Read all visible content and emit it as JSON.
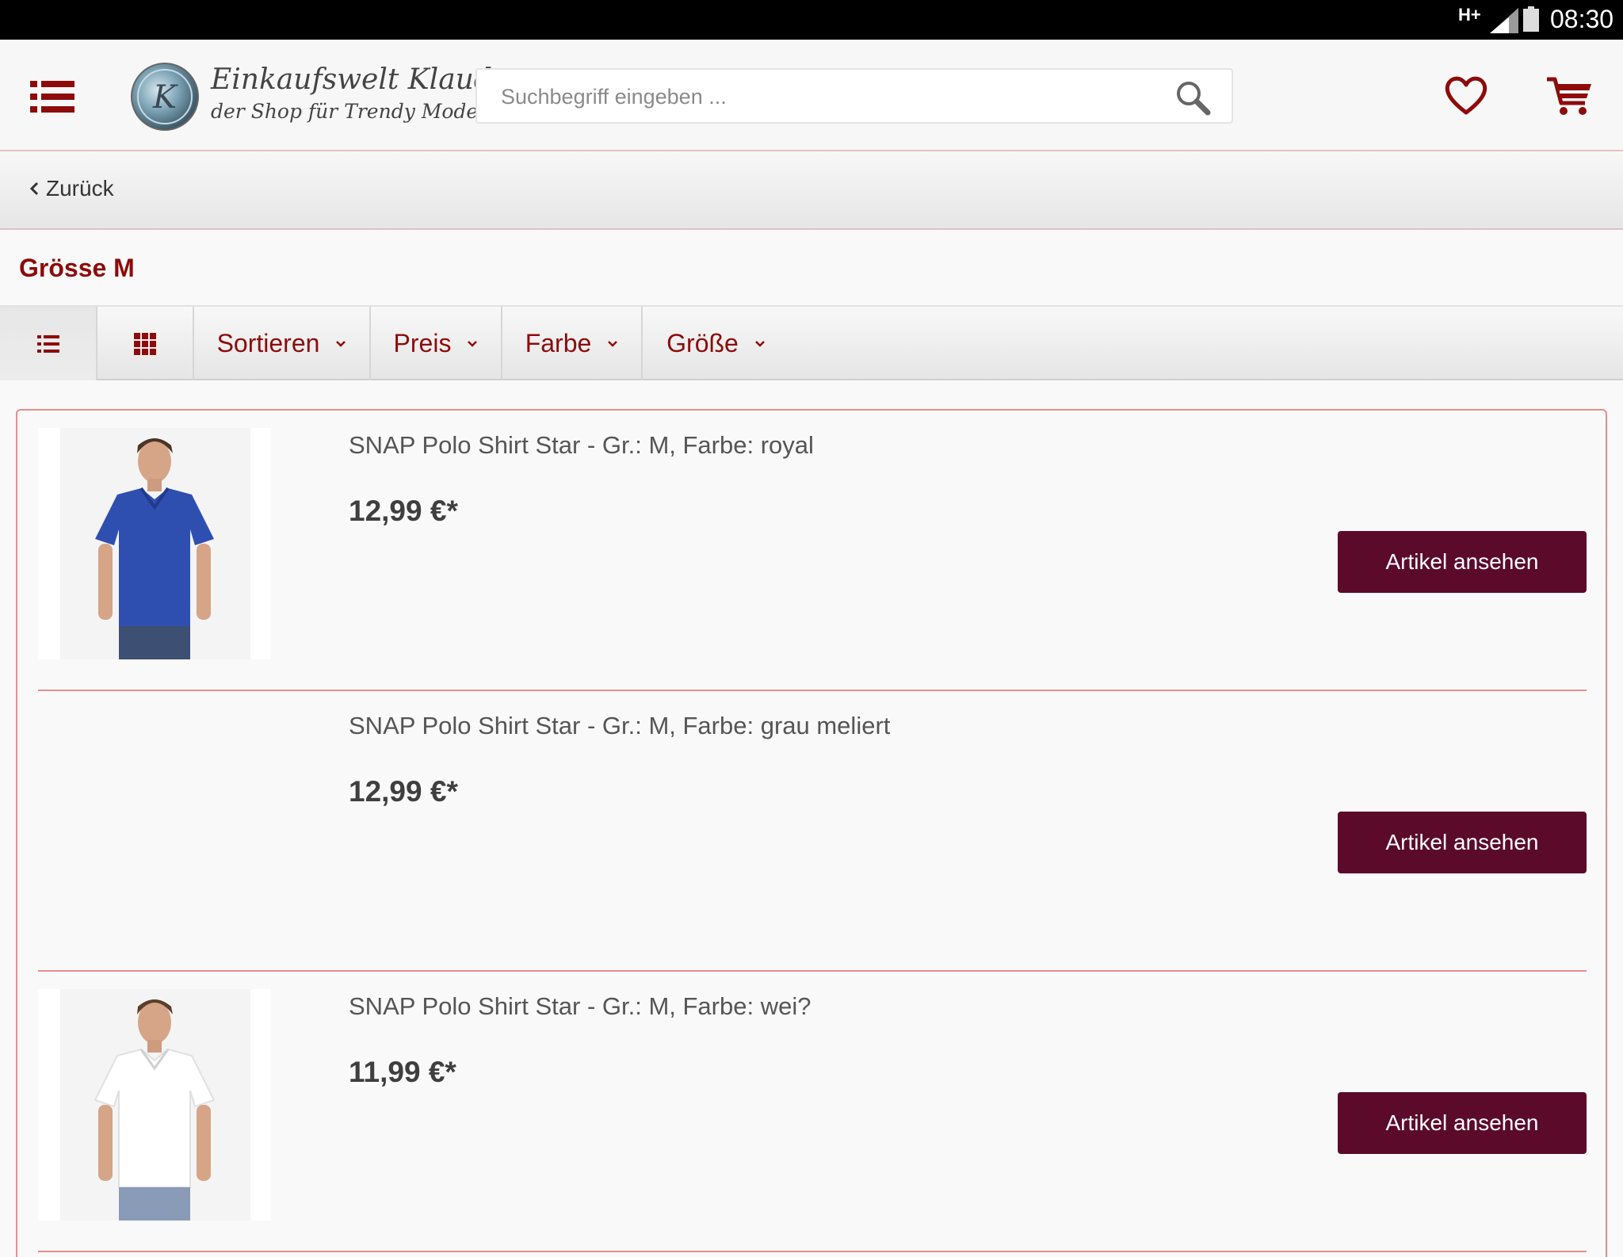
{
  "status_bar": {
    "network": "H+",
    "time": "08:30"
  },
  "header": {
    "logo_line1": "Einkaufswelt Klaudy",
    "logo_line2": "der Shop für Trendy Mode",
    "logo_seal_letter": "K",
    "search_placeholder": "Suchbegriff eingeben ...",
    "icons": [
      "menu-icon",
      "search-icon",
      "heart-icon",
      "cart-icon"
    ]
  },
  "back_label": "Zurück",
  "category_title": "Grösse M",
  "toolbar": {
    "list_view_icon": "list-view-icon",
    "grid_view_icon": "grid-view-icon",
    "filters": [
      {
        "label": "Sortieren"
      },
      {
        "label": "Preis"
      },
      {
        "label": "Farbe"
      },
      {
        "label": "Größe"
      }
    ]
  },
  "products": [
    {
      "name": "SNAP Polo Shirt Star - Gr.: M, Farbe: royal",
      "price": "12,99 €*",
      "button": "Artikel ansehen",
      "image_color": "#2f4fb0"
    },
    {
      "name": "SNAP Polo Shirt Star - Gr.: M, Farbe: grau meliert",
      "price": "12,99 €*",
      "button": "Artikel ansehen",
      "image_color": ""
    },
    {
      "name": "SNAP Polo Shirt Star - Gr.: M, Farbe: wei?",
      "price": "11,99 €*",
      "button": "Artikel ansehen",
      "image_color": "#ffffff"
    }
  ],
  "colors": {
    "brand_red": "#8d0b0b",
    "button_bg": "#5c0a2a",
    "list_border": "#e88c8c"
  }
}
